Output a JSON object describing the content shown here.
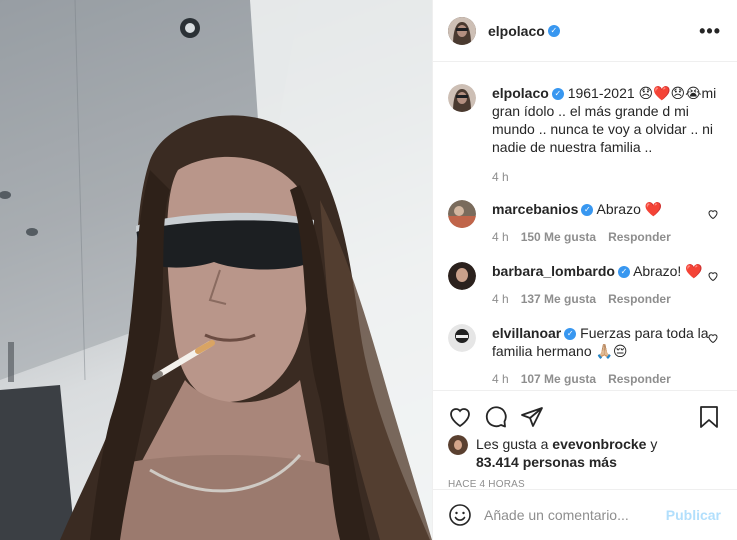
{
  "post": {
    "author": "elpolaco",
    "verified": true,
    "caption": {
      "username": "elpolaco",
      "text": "1961-2021 😞❤️😞😭mi gran ídolo .. el más grande d mi mundo .. nunca te voy a olvidar .. ni nadie de nuestra familia ..",
      "time": "4 h"
    },
    "comments": [
      {
        "username": "marcebanios",
        "text": "Abrazo ❤️",
        "time": "4 h",
        "likes": "150 Me gusta",
        "reply": "Responder"
      },
      {
        "username": "barbara_lombardo",
        "text": "Abrazo! ❤️",
        "time": "4 h",
        "likes": "137 Me gusta",
        "reply": "Responder"
      },
      {
        "username": "elvillanoar",
        "text": "Fuerzas para toda la familia hermano 🙏🏼😔",
        "time": "4 h",
        "likes": "107 Me gusta",
        "reply": "Responder"
      }
    ],
    "likes_prefix": "Les gusta a",
    "likes_user": "evevonbrocke",
    "likes_middle": "y",
    "likes_count": "83.414 personas más",
    "posted_ago": "HACE 4 HORAS",
    "add_comment_placeholder": "Añade un comentario...",
    "publish_label": "Publicar",
    "more_label": "•••"
  },
  "colors": {
    "verified": "#3897f0",
    "muted": "#8e8e8e",
    "publish_disabled": "#b2dffc"
  }
}
